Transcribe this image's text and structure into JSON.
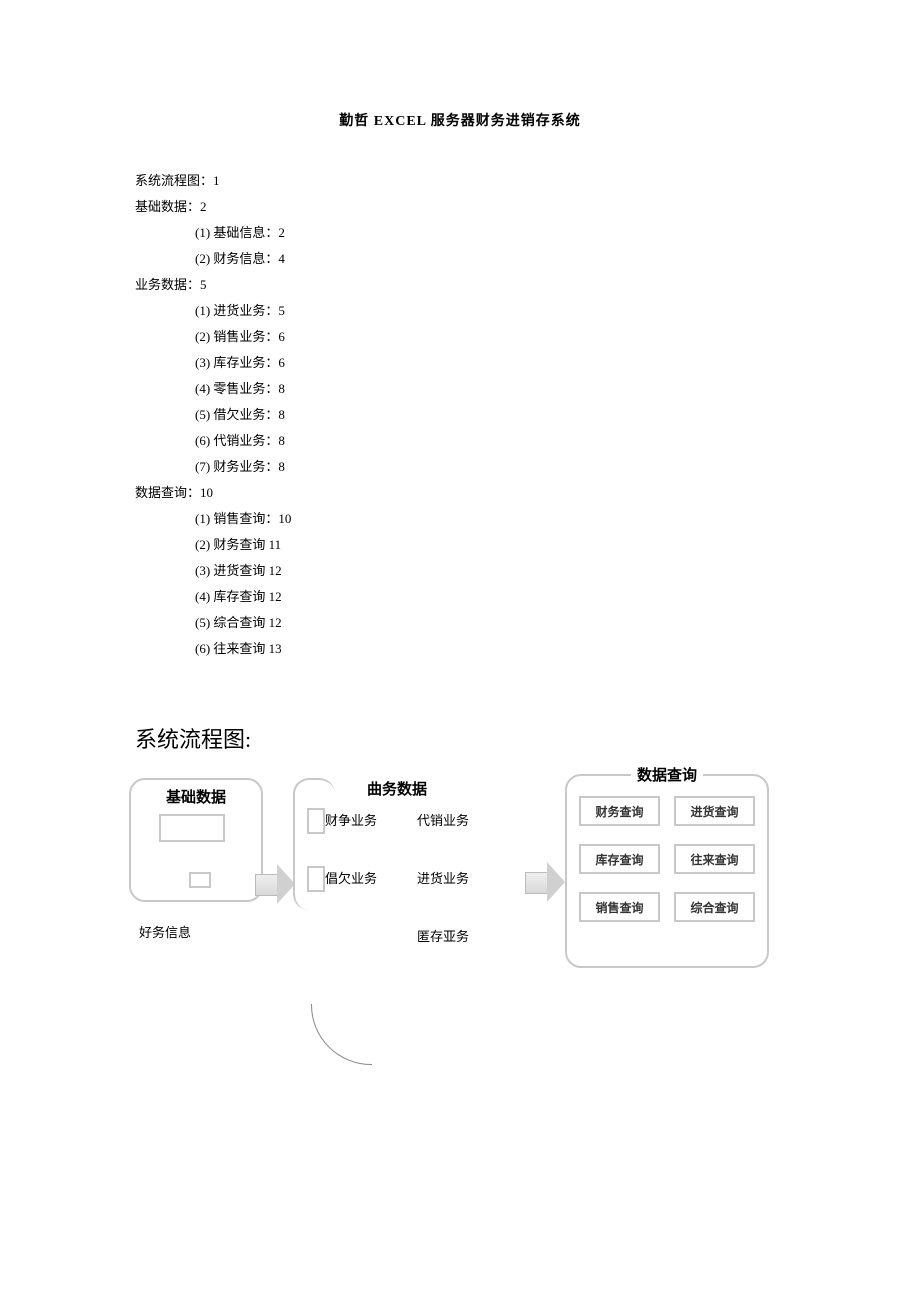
{
  "title": "勤哲 EXCEL 服务器财务进销存系统",
  "toc": {
    "l1a": "系统流程图：1",
    "l1b": "基础数据：2",
    "l2a": "(1) 基础信息：2",
    "l2b": "(2) 财务信息：4",
    "l1c": "业务数据：5",
    "l2c": "(1) 进货业务：5",
    "l2d": "(2) 销售业务：6",
    "l2e": "(3) 库存业务：6",
    "l2f": "(4) 零售业务：8",
    "l2g": "(5) 借欠业务：8",
    "l2h": "(6) 代销业务：8",
    "l2i": "(7) 财务业务：8",
    "l1d": "数据查询：10",
    "l2j": "(1) 销售查询：10",
    "l2k": "(2) 财务查询 11",
    "l2l": "(3) 进货查询 12",
    "l2m": "(4) 库存查询 12",
    "l2n": "(5) 综合查询 12",
    "l2o": "(6) 往来查询 13"
  },
  "flow_heading": "系统流程图:",
  "diagram": {
    "panel1_title": "基础数据",
    "panel2_title": "曲务数据",
    "panel3_title": "数据查询",
    "left_label": "好务信息",
    "mid": {
      "a": "财争业务",
      "b": "代销业务",
      "c": "倡欠业务",
      "d": "进货业务",
      "e": "匿存亚务"
    },
    "right": {
      "a": "财务查询",
      "b": "进货查询",
      "c": "库存查询",
      "d": "往来查询",
      "e": "销售查询",
      "f": "综合查询"
    }
  }
}
